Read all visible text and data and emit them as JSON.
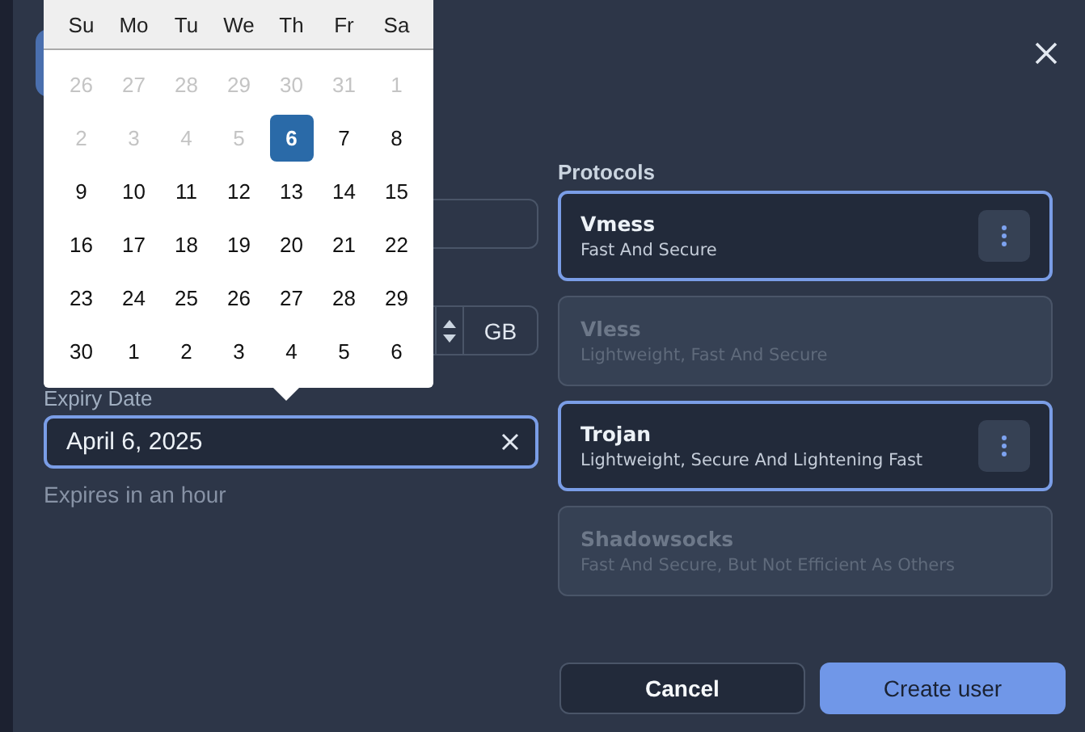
{
  "calendar": {
    "weekdays": [
      "Su",
      "Mo",
      "Tu",
      "We",
      "Th",
      "Fr",
      "Sa"
    ],
    "days": [
      {
        "label": "26",
        "muted": true,
        "selected": false
      },
      {
        "label": "27",
        "muted": true,
        "selected": false
      },
      {
        "label": "28",
        "muted": true,
        "selected": false
      },
      {
        "label": "29",
        "muted": true,
        "selected": false
      },
      {
        "label": "30",
        "muted": true,
        "selected": false
      },
      {
        "label": "31",
        "muted": true,
        "selected": false
      },
      {
        "label": "1",
        "muted": true,
        "selected": false
      },
      {
        "label": "2",
        "muted": true,
        "selected": false
      },
      {
        "label": "3",
        "muted": true,
        "selected": false
      },
      {
        "label": "4",
        "muted": true,
        "selected": false
      },
      {
        "label": "5",
        "muted": true,
        "selected": false
      },
      {
        "label": "6",
        "muted": false,
        "selected": true
      },
      {
        "label": "7",
        "muted": false,
        "selected": false
      },
      {
        "label": "8",
        "muted": false,
        "selected": false
      },
      {
        "label": "9",
        "muted": false,
        "selected": false
      },
      {
        "label": "10",
        "muted": false,
        "selected": false
      },
      {
        "label": "11",
        "muted": false,
        "selected": false
      },
      {
        "label": "12",
        "muted": false,
        "selected": false
      },
      {
        "label": "13",
        "muted": false,
        "selected": false
      },
      {
        "label": "14",
        "muted": false,
        "selected": false
      },
      {
        "label": "15",
        "muted": false,
        "selected": false
      },
      {
        "label": "16",
        "muted": false,
        "selected": false
      },
      {
        "label": "17",
        "muted": false,
        "selected": false
      },
      {
        "label": "18",
        "muted": false,
        "selected": false
      },
      {
        "label": "19",
        "muted": false,
        "selected": false
      },
      {
        "label": "20",
        "muted": false,
        "selected": false
      },
      {
        "label": "21",
        "muted": false,
        "selected": false
      },
      {
        "label": "22",
        "muted": false,
        "selected": false
      },
      {
        "label": "23",
        "muted": false,
        "selected": false
      },
      {
        "label": "24",
        "muted": false,
        "selected": false
      },
      {
        "label": "25",
        "muted": false,
        "selected": false
      },
      {
        "label": "26",
        "muted": false,
        "selected": false
      },
      {
        "label": "27",
        "muted": false,
        "selected": false
      },
      {
        "label": "28",
        "muted": false,
        "selected": false
      },
      {
        "label": "29",
        "muted": false,
        "selected": false
      },
      {
        "label": "30",
        "muted": false,
        "selected": false
      },
      {
        "label": "1",
        "muted": false,
        "selected": false
      },
      {
        "label": "2",
        "muted": false,
        "selected": false
      },
      {
        "label": "3",
        "muted": false,
        "selected": false
      },
      {
        "label": "4",
        "muted": false,
        "selected": false
      },
      {
        "label": "5",
        "muted": false,
        "selected": false
      },
      {
        "label": "6",
        "muted": false,
        "selected": false
      }
    ]
  },
  "data_limit": {
    "unit": "GB"
  },
  "expiry": {
    "label": "Expiry Date",
    "value": "April 6, 2025",
    "hint": "Expires in an hour"
  },
  "protocols": {
    "title": "Protocols",
    "items": [
      {
        "name": "Vmess",
        "description": "Fast And Secure",
        "selected": true
      },
      {
        "name": "Vless",
        "description": "Lightweight, Fast And Secure",
        "selected": false
      },
      {
        "name": "Trojan",
        "description": "Lightweight, Secure And Lightening Fast",
        "selected": true
      },
      {
        "name": "Shadowsocks",
        "description": "Fast And Secure, But Not Efficient As Others",
        "selected": false
      }
    ]
  },
  "buttons": {
    "cancel": "Cancel",
    "submit": "Create user"
  }
}
